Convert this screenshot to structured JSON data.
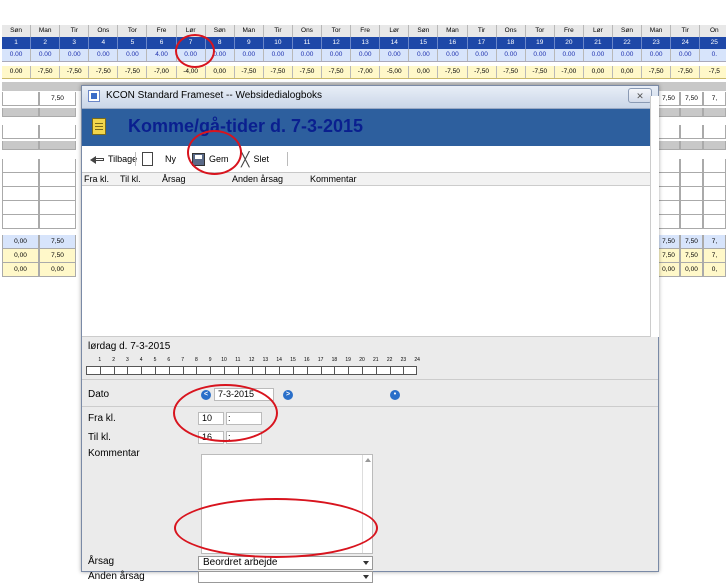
{
  "sheet": {
    "days": [
      "Søn",
      "Man",
      "Tir",
      "Ons",
      "Tor",
      "Fre",
      "Lør",
      "Søn",
      "Man",
      "Tir",
      "Ons",
      "Tor",
      "Fre",
      "Lør",
      "Søn",
      "Man",
      "Tir",
      "Ons",
      "Tor",
      "Fre",
      "Lør",
      "Søn",
      "Man",
      "Tir",
      "On"
    ],
    "dates": [
      "1",
      "2",
      "3",
      "4",
      "5",
      "6",
      "7",
      "8",
      "9",
      "10",
      "11",
      "12",
      "13",
      "14",
      "15",
      "16",
      "17",
      "18",
      "19",
      "20",
      "21",
      "22",
      "23",
      "24",
      "25"
    ],
    "hours": [
      "0.00",
      "0.00",
      "0.00",
      "0.00",
      "0.00",
      "4.00",
      "0.00",
      "0.00",
      "0.00",
      "0.00",
      "0.00",
      "0.00",
      "0.00",
      "0.00",
      "0.00",
      "0.00",
      "0.00",
      "0.00",
      "0.00",
      "0.00",
      "0.00",
      "0.00",
      "0.00",
      "0.00",
      "0."
    ],
    "norm": [
      "0.00",
      "-7,50",
      "-7,50",
      "-7,50",
      "-7,50",
      "-7,00",
      "-4,00",
      "0,00",
      "-7,50",
      "-7,50",
      "-7,50",
      "-7,50",
      "-7,00",
      "-5,00",
      "0,00",
      "-7,50",
      "-7,50",
      "-7,50",
      "-7,50",
      "-7,00",
      "0,00",
      "0,00",
      "-7,50",
      "-7,50",
      "-7,5"
    ],
    "left_row1": [
      "",
      "7,50"
    ],
    "left_blue": [
      "0,00",
      "7,50"
    ],
    "left_yel1": [
      "0,00",
      "7,50"
    ],
    "left_yel2": [
      "0,00",
      "0,00"
    ],
    "right_row1": [
      "7,50",
      "7,50",
      "7,"
    ],
    "right_blue": [
      "7,50",
      "7,50",
      "7,"
    ],
    "right_yel1": [
      "7,50",
      "7,50",
      "7,"
    ],
    "right_yel2": [
      "0,00",
      "0,00",
      "0,"
    ]
  },
  "dialog": {
    "window_title": "KCON Standard Frameset -- Websidedialogboks",
    "close_glyph": "✕",
    "heading": "Komme/gå-tider d. 7-3-2015",
    "toolbar": {
      "back_label": "Tilbage",
      "new_label": "Ny",
      "save_label": "Gem",
      "delete_label": "Slet"
    },
    "columns": [
      "Fra kl.",
      "Til kl.",
      "Årsag",
      "Anden årsag",
      "Kommentar"
    ],
    "day_label": "lørdag d. 7-3-2015",
    "hour_numbers": [
      "1",
      "2",
      "3",
      "4",
      "5",
      "6",
      "7",
      "8",
      "9",
      "10",
      "11",
      "12",
      "13",
      "14",
      "15",
      "16",
      "17",
      "18",
      "19",
      "20",
      "21",
      "22",
      "23",
      "24"
    ],
    "form": {
      "dato_label": "Dato",
      "dato_value": "7-3-2015",
      "fra_label": "Fra kl.",
      "fra_hour": "10",
      "fra_min": "",
      "til_label": "Til kl.",
      "til_hour": "16",
      "til_min": "",
      "colon": ":",
      "kommentar_label": "Kommentar",
      "kommentar_value": "",
      "aarsag_label": "Årsag",
      "aarsag_value": "Beordret arbejde",
      "anden_label": "Anden årsag",
      "anden_value": ""
    }
  },
  "colors": {
    "header_bg": "#2d5f9e",
    "heading_text": "#0a1f8f",
    "annotation_red": "#d8141e"
  }
}
